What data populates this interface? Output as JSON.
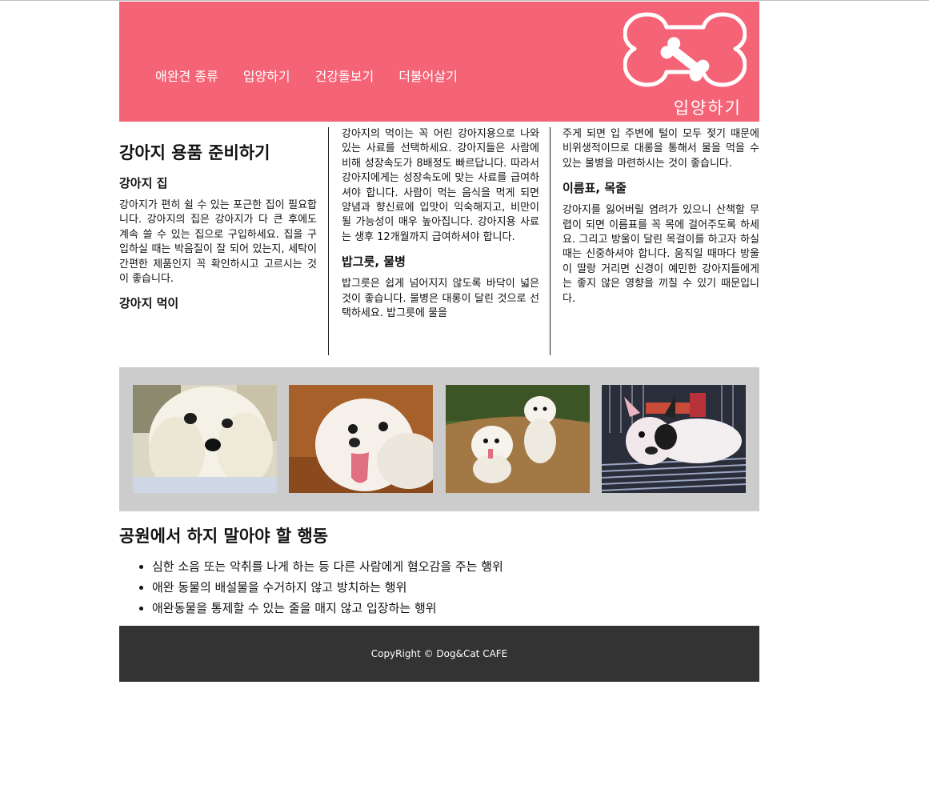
{
  "nav": {
    "items": [
      "애완견 종류",
      "입양하기",
      "건강돌보기",
      "더불어살기"
    ]
  },
  "header": {
    "logo_text": "입양하기",
    "logo_icon": "bone-icon",
    "background": "#f56476"
  },
  "article": {
    "title": "강아지 용품 준비하기",
    "house_heading": "강아지 집",
    "house_text": "강아지가 편히 쉴 수 있는 포근한 집이 필요합니다. 강아지의 집은 강아지가 다 큰 후에도 계속 쓸 수 있는 집으로 구입하세요. 집을 구입하실 때는 박음질이 잘 되어 있는지, 세탁이 간편한 제품인지 꼭 확인하시고 고르시는 것이 좋습니다.",
    "food_heading": "강아지 먹이",
    "food_text": "강아지의 먹이는 꼭 어린 강아지용으로 나와있는 사료를 선택하세요. 강아지들은 사람에 비해 성장속도가 8배정도 빠르답니다. 따라서 강아지에게는 성장속도에 맞는 사료를 급여하셔야 합니다. 사람이 먹는 음식을 먹게 되면 양념과 향신료에 입맛이 익숙해지고, 비만이 될 가능성이 매우 높아집니다. 강아지용 사료는 생후 12개월까지 급여하셔야 합니다.",
    "bowl_heading": "밥그릇, 물병",
    "bowl_text": "밥그릇은 쉽게 넘어지지 않도록 바닥이 넓은 것이 좋습니다. 물병은 대롱이 달린 것으로 선택하세요. 밥그릇에 물을 주게 되면 입 주변에 털이 모두 젖기 때문에 비위생적이므로 대롱을 통해서 물을 먹을 수 있는 물병을 마련하시는 것이 좋습니다.",
    "tag_heading": "이름표, 목줄",
    "tag_text": "강아지를 잃어버릴 염려가 있으니 산책할 무렵이 되면 이름표를 꼭 목에 걸어주도록 하세요. 그리고 방울이 달린 목걸이를 하고자 하실 때는 신중하셔야 합니다. 움직일 때마다 방울이 딸랑 거리면 신경이 예민한 강아지들에게는 좋지 않은 영향을 끼칠 수 있기 때문입니다."
  },
  "gallery": {
    "photos": [
      "maltese-puppy-closeup",
      "maltese-tongue-out",
      "two-maltese-on-dirt",
      "french-bulldog-on-grate"
    ],
    "background": "#cccccc"
  },
  "rules": {
    "title": "공원에서 하지 말아야 할 행동",
    "items": [
      "심한 소음 또는 악취를 나게 하는 등 다른 사람에게 혐오감을 주는 행위",
      "애완 동물의 배설물을 수거하지 않고 방치하는 행위",
      "애완동물을 통제할 수 있는 줄을 매지 않고 입장하는 행위"
    ]
  },
  "footer": {
    "text": "CopyRight © Dog&Cat CAFE",
    "background": "#333333"
  }
}
